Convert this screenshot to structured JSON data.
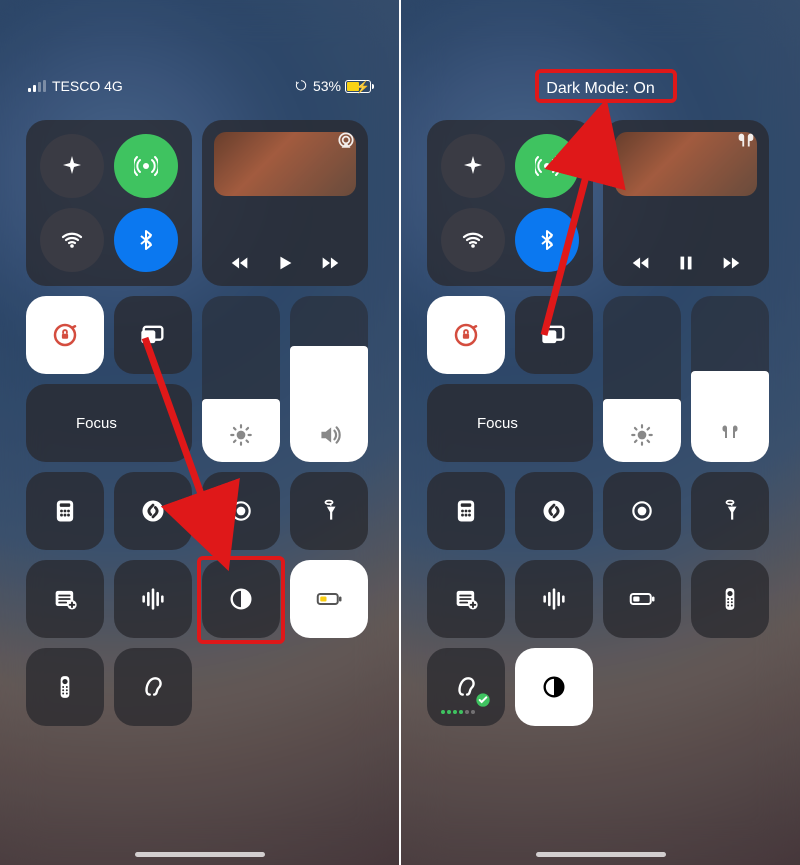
{
  "left": {
    "status": {
      "carrier": "TESCO 4G",
      "battery_pct": "53%"
    },
    "connectivity": {
      "airplane": "airplane-icon",
      "cellular": "cellular-icon",
      "wifi": "wifi-icon",
      "bluetooth": "bluetooth-icon",
      "cellular_on": true,
      "bluetooth_on": true
    },
    "media": {
      "airplay_icon": "airplay-icon",
      "playing": false
    },
    "focus": {
      "label": "Focus"
    },
    "sliders": {
      "brightness_pct": 38,
      "volume_pct": 70
    },
    "tiles": {
      "row1": [
        "calculator",
        "shazam",
        "screen-record",
        "flashlight"
      ],
      "row2": [
        "notes",
        "voice-memo",
        "dark-mode",
        "low-power"
      ],
      "row3": [
        "apple-tv-remote",
        "hearing",
        "",
        ""
      ]
    },
    "annotation": {
      "highlight_target": "dark-mode",
      "arrow_from": "screen-mirror",
      "arrow_to": "dark-mode"
    }
  },
  "right": {
    "status": {
      "dark_mode_label": "Dark Mode: On"
    },
    "connectivity": {
      "airplane": "airplane-icon",
      "cellular": "cellular-icon",
      "wifi": "wifi-icon",
      "bluetooth": "bluetooth-icon",
      "cellular_on": true,
      "bluetooth_on": true
    },
    "media": {
      "airpods_icon": "airpods-icon",
      "playing": true
    },
    "focus": {
      "label": "Focus"
    },
    "sliders": {
      "brightness_pct": 38,
      "airpods_volume_pct": 55
    },
    "tiles": {
      "row1": [
        "calculator",
        "shazam",
        "screen-record",
        "flashlight"
      ],
      "row2": [
        "notes",
        "voice-memo",
        "low-power",
        "apple-tv-remote"
      ],
      "row3": [
        "hearing-on",
        "dark-mode-on",
        "",
        ""
      ]
    },
    "annotation": {
      "highlight_target": "dark-mode-label",
      "arrow_from": "screen-mirror",
      "arrow_to": "dark-mode-label"
    }
  },
  "colors": {
    "highlight": "#f01314",
    "green": "#34c759",
    "blue": "#007aff",
    "yellow": "#ffd400"
  }
}
